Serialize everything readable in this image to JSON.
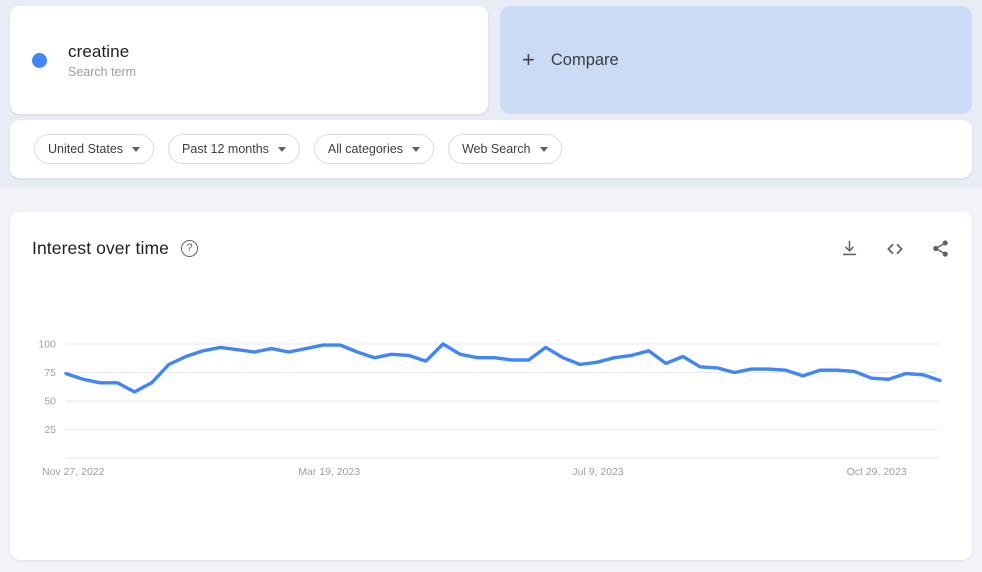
{
  "term": {
    "title": "creatine",
    "subtitle": "Search term",
    "dot_color": "#4285f4"
  },
  "compare": {
    "label": "Compare",
    "plus": "+"
  },
  "filters": [
    {
      "label": "United States"
    },
    {
      "label": "Past 12 months"
    },
    {
      "label": "All categories"
    },
    {
      "label": "Web Search"
    }
  ],
  "chart_card": {
    "title": "Interest over time",
    "help": "?",
    "actions": [
      {
        "name": "download-icon"
      },
      {
        "name": "embed-icon"
      },
      {
        "name": "share-icon"
      }
    ]
  },
  "chart_data": {
    "type": "line",
    "title": "Interest over time",
    "xlabel": "",
    "ylabel": "",
    "ylim": [
      0,
      100
    ],
    "yticks": [
      25,
      50,
      75,
      100
    ],
    "grid": true,
    "legend": "creatine",
    "line_color": "#4285f4",
    "xtick_labels": [
      "Nov 27, 2022",
      "Mar 19, 2023",
      "Jul 9, 2023",
      "Oct 29, 2023"
    ],
    "xtick_positions": [
      0,
      16,
      32,
      48
    ],
    "x": [
      "Nov 27, 2022",
      "Dec 4, 2022",
      "Dec 11, 2022",
      "Dec 18, 2022",
      "Dec 25, 2022",
      "Jan 1, 2023",
      "Jan 8, 2023",
      "Jan 15, 2023",
      "Jan 22, 2023",
      "Jan 29, 2023",
      "Feb 5, 2023",
      "Feb 12, 2023",
      "Feb 19, 2023",
      "Feb 26, 2023",
      "Mar 5, 2023",
      "Mar 12, 2023",
      "Mar 19, 2023",
      "Mar 26, 2023",
      "Apr 2, 2023",
      "Apr 9, 2023",
      "Apr 16, 2023",
      "Apr 23, 2023",
      "Apr 30, 2023",
      "May 7, 2023",
      "May 14, 2023",
      "May 21, 2023",
      "May 28, 2023",
      "Jun 4, 2023",
      "Jun 11, 2023",
      "Jun 18, 2023",
      "Jun 25, 2023",
      "Jul 2, 2023",
      "Jul 9, 2023",
      "Jul 16, 2023",
      "Jul 23, 2023",
      "Jul 30, 2023",
      "Aug 6, 2023",
      "Aug 13, 2023",
      "Aug 20, 2023",
      "Aug 27, 2023",
      "Sep 3, 2023",
      "Sep 10, 2023",
      "Sep 17, 2023",
      "Sep 24, 2023",
      "Oct 1, 2023",
      "Oct 8, 2023",
      "Oct 15, 2023",
      "Oct 22, 2023",
      "Oct 29, 2023",
      "Nov 5, 2023",
      "Nov 12, 2023",
      "Nov 19, 2023"
    ],
    "values": [
      74,
      69,
      66,
      66,
      58,
      66,
      82,
      89,
      94,
      97,
      95,
      93,
      96,
      93,
      96,
      99,
      99,
      93,
      88,
      91,
      90,
      85,
      100,
      91,
      88,
      88,
      86,
      86,
      97,
      88,
      82,
      84,
      88,
      90,
      94,
      83,
      89,
      80,
      79,
      75,
      78,
      78,
      77,
      72,
      77,
      77,
      76,
      70,
      69,
      74,
      73,
      68
    ]
  }
}
